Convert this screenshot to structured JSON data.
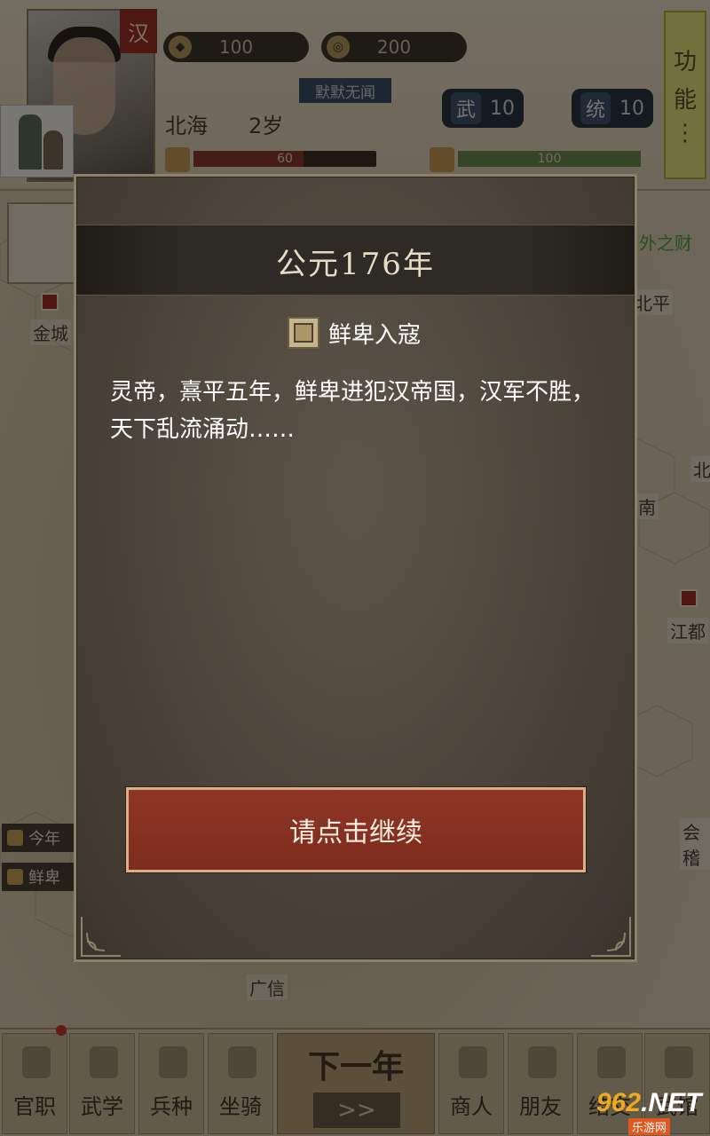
{
  "player": {
    "faction_tag": "汉",
    "origin": "北海",
    "age": "2岁",
    "gold": "100",
    "coins": "200",
    "title": "默默无闻",
    "stats": [
      {
        "key": "武",
        "value": "10"
      },
      {
        "key": "统",
        "value": "10"
      }
    ],
    "health": {
      "value": "60",
      "fraction": 0.6
    },
    "energy": {
      "value": "100",
      "fraction": 1.0
    }
  },
  "function_button": {
    "lines": [
      "功",
      "能",
      "⋮"
    ]
  },
  "map": {
    "labels": [
      "金城",
      "北平",
      "南",
      "江都",
      "会稽",
      "广信",
      "北"
    ],
    "right_gold_label": "外之财",
    "side_news": [
      "今年",
      "鲜卑"
    ]
  },
  "dialog": {
    "title": "公元176年",
    "event_name": "鲜卑入寇",
    "description": "灵帝，熹平五年，鲜卑进犯汉帝国，汉军不胜，天下乱流涌动……",
    "continue_label": "请点击继续"
  },
  "bottom_nav": {
    "items": [
      "官职",
      "武学",
      "兵种",
      "坐骑",
      "商人",
      "朋友",
      "结交",
      "武馆"
    ],
    "next_year": {
      "label": "下一年",
      "fast_label": ">>"
    }
  },
  "watermark": {
    "brand": "962",
    "suffix": ".NET",
    "sub": "乐游网"
  },
  "colors": {
    "dialog_bg": "#4b443a",
    "continue_button": "#8f3626",
    "func_button": "#e9e07a",
    "faction_red": "#9a2f24"
  }
}
